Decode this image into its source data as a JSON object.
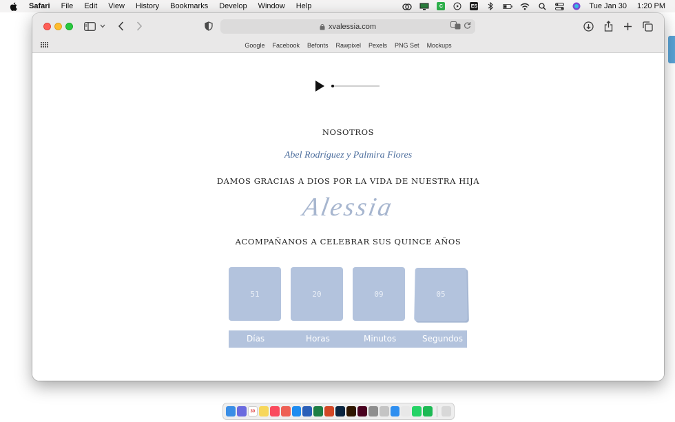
{
  "menubar": {
    "app_name": "Safari",
    "menus": [
      "File",
      "Edit",
      "View",
      "History",
      "Bookmarks",
      "Develop",
      "Window",
      "Help"
    ],
    "input_source": "ES",
    "date": "Tue Jan 30",
    "time": "1:20 PM"
  },
  "browser": {
    "url": "xvalessia.com",
    "favorites": [
      "Google",
      "Facebook",
      "Befonts",
      "Rawpixel",
      "Pexels",
      "PNG Set",
      "Mockups"
    ]
  },
  "page": {
    "audio_progress": 0,
    "heading": "NOSOTROS",
    "parents": "Abel Rodríguez y Palmira Flores",
    "thanks": "DAMOS GRACIAS A DIOS POR LA VIDA DE NUESTRA HIJA",
    "name": "Alessia",
    "invite": "ACOMPAÑANOS A CELEBRAR SUS QUINCE AÑOS",
    "countdown": {
      "values": [
        "51",
        "20",
        "09",
        "05"
      ],
      "labels": [
        "Días",
        "Horas",
        "Minutos",
        "Segundos"
      ]
    }
  },
  "dock": {
    "calendar_day": "30"
  },
  "colors": {
    "accent_blue": "#b3c3dd",
    "script_blue": "#a7b6cf",
    "parents_blue": "#4e6f9e"
  }
}
